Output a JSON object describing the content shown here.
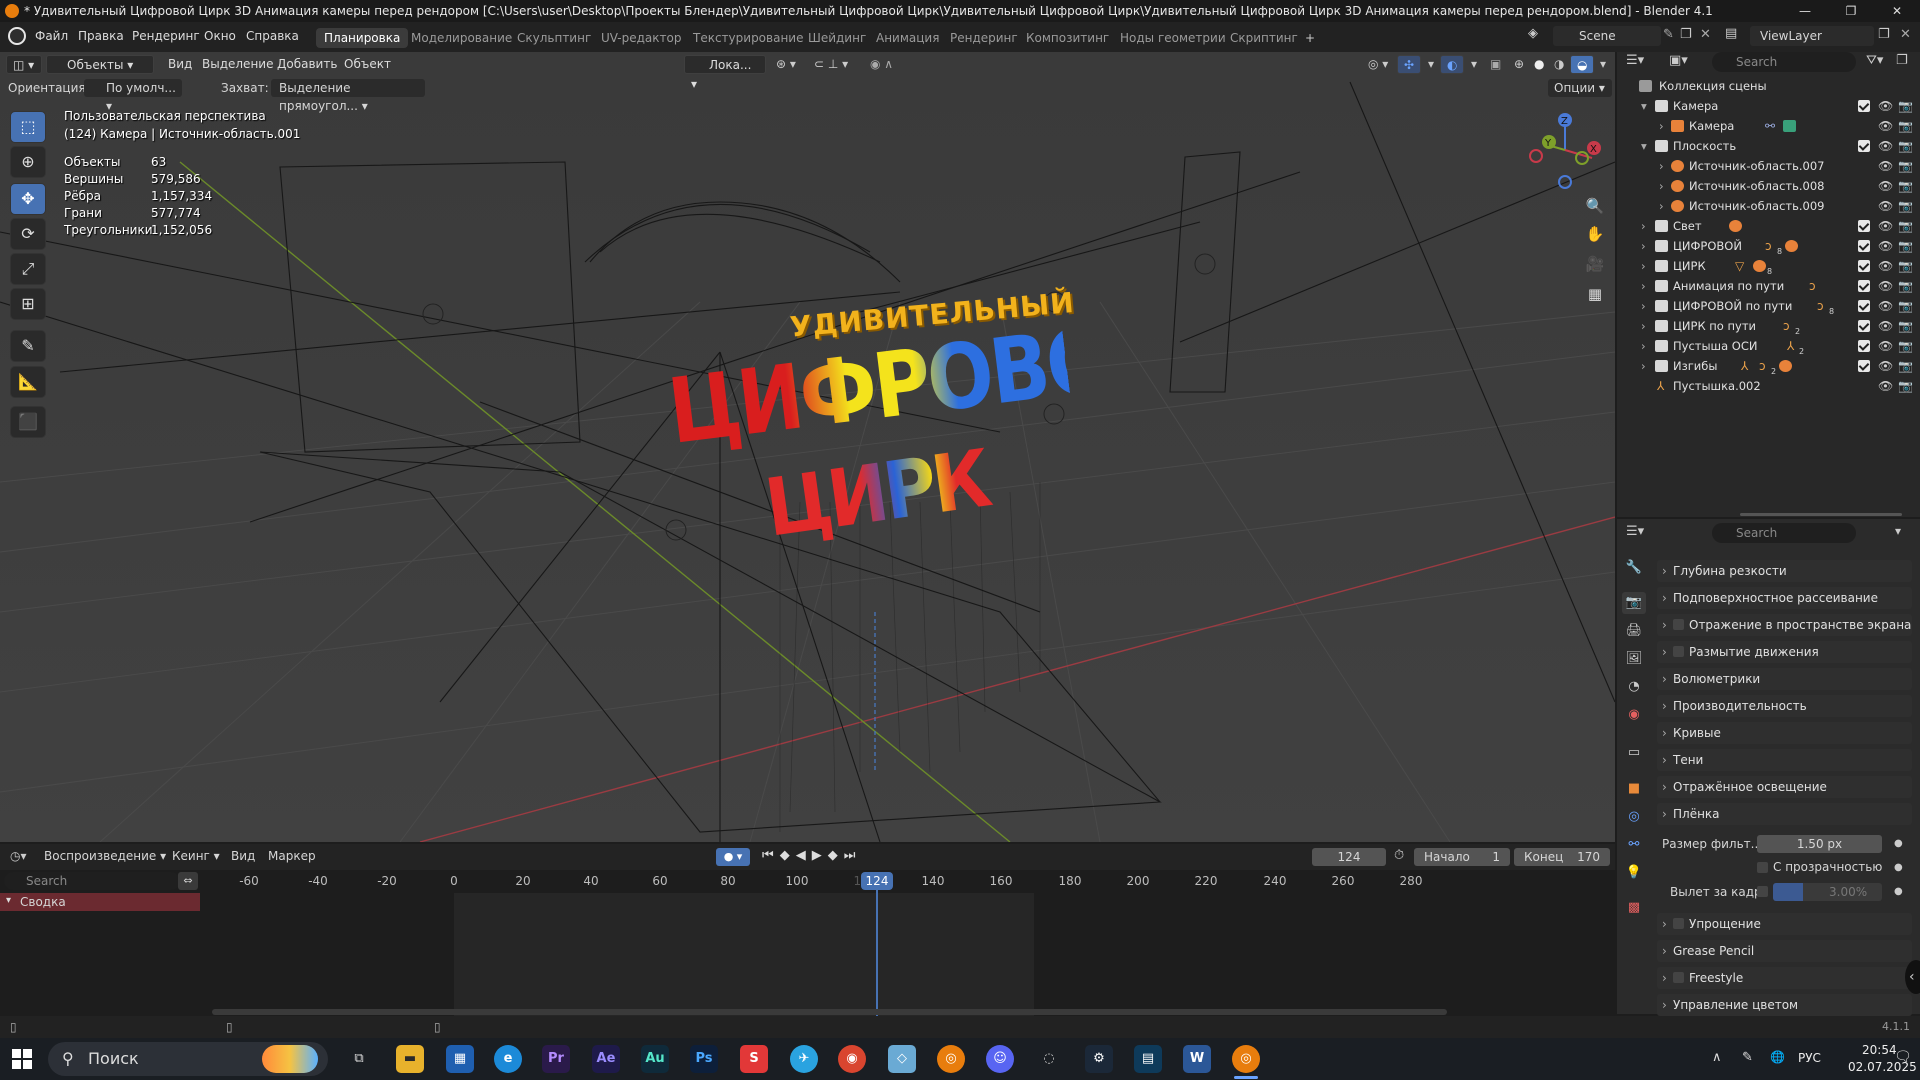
{
  "window": {
    "title": "* Удивительный Цифровой Цирк 3D Анимация камеры перед рендором [C:\\Users\\user\\Desktop\\Проекты Блендер\\Удивительный Цифровой Цирк\\Удивительный Цифровой Цирк\\Удивительный Цифровой Цирк 3D Анимация камеры перед рендором.blend] - Blender 4.1"
  },
  "menu": {
    "items": [
      "Файл",
      "Правка",
      "Рендеринг",
      "Окно",
      "Справка"
    ],
    "workspaces": [
      "Планировка",
      "Моделирование",
      "Скульптинг",
      "UV-редактор",
      "Текстурирование",
      "Шейдинг",
      "Анимация",
      "Рендеринг",
      "Композитинг",
      "Ноды геометрии",
      "Скриптинг"
    ],
    "active_workspace": "Планировка",
    "add_tab": "+",
    "scene": "Scene",
    "view_layer": "ViewLayer"
  },
  "viewport_header": {
    "mode": "Объекты",
    "view": "Вид",
    "select": "Выделение",
    "add": "Добавить",
    "object": "Объект",
    "transform_space": "Лока...",
    "orientation_label": "Ориентация:",
    "orientation_value": "По умолч...",
    "snap_label": "Захват:",
    "snap_value": "Выделение прямоугол...",
    "options": "Опции"
  },
  "viewport_overlay": {
    "perspective": "Пользовательская перспектива",
    "active": "(124) Камера | Источник-область.001",
    "stats": [
      {
        "label": "Объекты",
        "value": "63"
      },
      {
        "label": "Вершины",
        "value": "579,586"
      },
      {
        "label": "Рёбра",
        "value": "1,157,334"
      },
      {
        "label": "Грани",
        "value": "577,774"
      },
      {
        "label": "Треугольники",
        "value": "1,152,056"
      }
    ],
    "title_small": "УДИВИТЕЛЬНЫЙ",
    "title_big": "ЦИФРОВОЙ",
    "title_circus": "ЦИРК",
    "gizmo_labels": {
      "z": "Z",
      "y": "Y",
      "x": "X"
    }
  },
  "outliner": {
    "search_placeholder": "Search",
    "root": "Коллекция сцены",
    "rows": [
      {
        "label": "Камера",
        "indent": 0
      },
      {
        "label": "Камера",
        "indent": 1
      },
      {
        "label": "Плоскость",
        "indent": 0
      },
      {
        "label": "Источник-область.007",
        "indent": 1
      },
      {
        "label": "Источник-область.008",
        "indent": 1
      },
      {
        "label": "Источник-область.009",
        "indent": 1
      },
      {
        "label": "Свет",
        "indent": 0
      },
      {
        "label": "ЦИФРОВОЙ",
        "indent": 0
      },
      {
        "label": "ЦИРК",
        "indent": 0
      },
      {
        "label": "Анимация по пути",
        "indent": 0
      },
      {
        "label": "ЦИФРОВОЙ по пути",
        "indent": 0
      },
      {
        "label": "ЦИРК по пути",
        "indent": 0
      },
      {
        "label": "Пустыша ОСИ",
        "indent": 0
      },
      {
        "label": "Изгибы",
        "indent": 0
      },
      {
        "label": "Пустышка.002",
        "indent": 0
      }
    ],
    "badges": [
      "8",
      "8",
      "8",
      "2",
      "2",
      "2"
    ]
  },
  "properties": {
    "search_placeholder": "Search",
    "panels": [
      "Глубина резкости",
      "Подповерхностное рассеивание",
      "Отражение в пространстве экрана",
      "Размытие движения",
      "Волюметрики",
      "Производительность",
      "Кривые",
      "Тени",
      "Отражённое освещение",
      "Плёнка"
    ],
    "film": {
      "filter_label": "Размер фильт...",
      "filter_value": "1.50 px",
      "transparent_label": "С прозрачностью",
      "overscan_label": "Вылет за кадр",
      "overscan_value": "3.00%"
    },
    "panels_after": [
      "Упрощение",
      "Grease Pencil",
      "Freestyle",
      "Управление цветом"
    ]
  },
  "timeline": {
    "playback": "Воспроизведение",
    "keying": "Кеинг",
    "view": "Вид",
    "marker": "Маркер",
    "current_frame": "124",
    "start_label": "Начало",
    "start": "1",
    "end_label": "Конец",
    "end": "170",
    "search_placeholder": "Search",
    "summary": "Сводка",
    "ticks": [
      "-60",
      "-40",
      "-20",
      "0",
      "20",
      "40",
      "60",
      "80",
      "100",
      "120",
      "140",
      "160",
      "180",
      "200",
      "220",
      "240",
      "260",
      "280"
    ],
    "playhead_label": "124"
  },
  "statusbar": {
    "version": "4.1.1"
  },
  "taskbar": {
    "search": "Поиск",
    "apps": [
      "Pr",
      "Ae",
      "Au",
      "Ps"
    ],
    "language": "РУС",
    "time": "20:54",
    "date": "02.07.2025"
  }
}
